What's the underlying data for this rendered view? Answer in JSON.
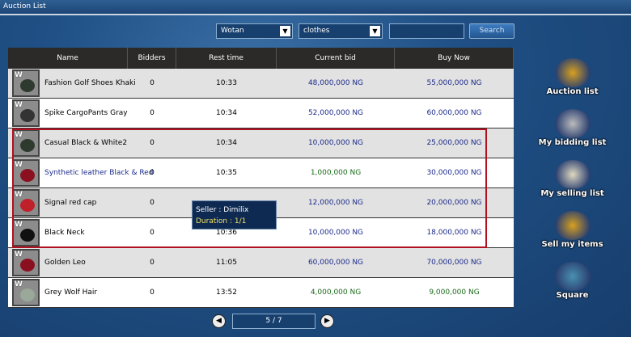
{
  "window": {
    "title": "Auction List"
  },
  "filters": {
    "server": "Wotan",
    "category": "clothes",
    "search_value": "",
    "search_label": "Search"
  },
  "table": {
    "headers": [
      "Name",
      "Bidders",
      "Rest time",
      "Current bid",
      "Buy Now"
    ],
    "rows": [
      {
        "name": "Fashion Golf Shoes Khaki",
        "bidders": "0",
        "rest": "10:33",
        "current": "48,000,000 NG",
        "buy": "55,000,000 NG",
        "icon": "shoes-icon",
        "name_color": "#000000",
        "current_color": "#1b2a8a",
        "buy_color": "#1b2a8a"
      },
      {
        "name": "Spike CargoPants Gray",
        "bidders": "0",
        "rest": "10:34",
        "current": "52,000,000 NG",
        "buy": "60,000,000 NG",
        "icon": "pants-icon",
        "name_color": "#000000",
        "current_color": "#1b2a8a",
        "buy_color": "#1b2a8a"
      },
      {
        "name": "Casual Black & White2",
        "bidders": "0",
        "rest": "10:34",
        "current": "10,000,000 NG",
        "buy": "25,000,000 NG",
        "icon": "shoes-icon",
        "name_color": "#000000",
        "current_color": "#1b2a8a",
        "buy_color": "#1b2a8a"
      },
      {
        "name": "Synthetic leather Black & Red",
        "bidders": "0",
        "rest": "10:35",
        "current": "1,000,000 NG",
        "buy": "30,000,000 NG",
        "icon": "glove-icon",
        "name_color": "#1b2a8a",
        "current_color": "#1a6a1a",
        "buy_color": "#1b2a8a"
      },
      {
        "name": "Signal red cap",
        "bidders": "0",
        "rest": "",
        "current": "12,000,000 NG",
        "buy": "20,000,000 NG",
        "icon": "cap-icon",
        "name_color": "#000000",
        "current_color": "#1b2a8a",
        "buy_color": "#1b2a8a"
      },
      {
        "name": "Black Neck",
        "bidders": "0",
        "rest": "10:36",
        "current": "10,000,000 NG",
        "buy": "18,000,000 NG",
        "icon": "neck-icon",
        "name_color": "#000000",
        "current_color": "#1b2a8a",
        "buy_color": "#1b2a8a"
      },
      {
        "name": "Golden Leo",
        "bidders": "0",
        "rest": "11:05",
        "current": "60,000,000 NG",
        "buy": "70,000,000 NG",
        "icon": "glove-icon",
        "name_color": "#000000",
        "current_color": "#1b2a8a",
        "buy_color": "#1b2a8a"
      },
      {
        "name": "Grey Wolf Hair",
        "bidders": "0",
        "rest": "13:52",
        "current": "4,000,000 NG",
        "buy": "9,000,000 NG",
        "icon": "hair-icon",
        "name_color": "#000000",
        "current_color": "#1a6a1a",
        "buy_color": "#1a6a1a"
      }
    ]
  },
  "tooltip": {
    "seller": "Seller : Dimilix",
    "duration": "Duration : 1/1"
  },
  "sidebar": [
    {
      "label": "Auction list",
      "icon": "auction-icon"
    },
    {
      "label": "My bidding list",
      "icon": "cart-icon"
    },
    {
      "label": "My selling list",
      "icon": "clipboard-icon"
    },
    {
      "label": "Sell my items",
      "icon": "sell-icon"
    },
    {
      "label": "Square",
      "icon": "building-icon"
    }
  ],
  "pager": {
    "text": "5 / 7"
  }
}
